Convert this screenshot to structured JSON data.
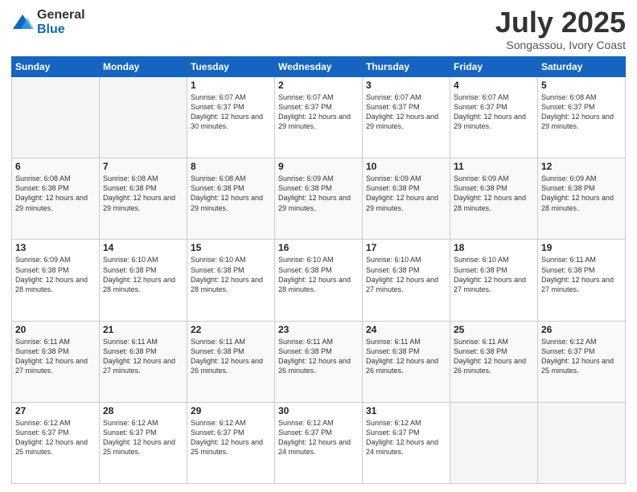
{
  "logo": {
    "general": "General",
    "blue": "Blue"
  },
  "title": {
    "month": "July 2025",
    "location": "Songassou, Ivory Coast"
  },
  "weekdays": [
    "Sunday",
    "Monday",
    "Tuesday",
    "Wednesday",
    "Thursday",
    "Friday",
    "Saturday"
  ],
  "weeks": [
    [
      {
        "day": "",
        "info": ""
      },
      {
        "day": "",
        "info": ""
      },
      {
        "day": "1",
        "info": "Sunrise: 6:07 AM\nSunset: 6:37 PM\nDaylight: 12 hours and 30 minutes."
      },
      {
        "day": "2",
        "info": "Sunrise: 6:07 AM\nSunset: 6:37 PM\nDaylight: 12 hours and 29 minutes."
      },
      {
        "day": "3",
        "info": "Sunrise: 6:07 AM\nSunset: 6:37 PM\nDaylight: 12 hours and 29 minutes."
      },
      {
        "day": "4",
        "info": "Sunrise: 6:07 AM\nSunset: 6:37 PM\nDaylight: 12 hours and 29 minutes."
      },
      {
        "day": "5",
        "info": "Sunrise: 6:08 AM\nSunset: 6:37 PM\nDaylight: 12 hours and 29 minutes."
      }
    ],
    [
      {
        "day": "6",
        "info": "Sunrise: 6:08 AM\nSunset: 6:38 PM\nDaylight: 12 hours and 29 minutes."
      },
      {
        "day": "7",
        "info": "Sunrise: 6:08 AM\nSunset: 6:38 PM\nDaylight: 12 hours and 29 minutes."
      },
      {
        "day": "8",
        "info": "Sunrise: 6:08 AM\nSunset: 6:38 PM\nDaylight: 12 hours and 29 minutes."
      },
      {
        "day": "9",
        "info": "Sunrise: 6:09 AM\nSunset: 6:38 PM\nDaylight: 12 hours and 29 minutes."
      },
      {
        "day": "10",
        "info": "Sunrise: 6:09 AM\nSunset: 6:38 PM\nDaylight: 12 hours and 29 minutes."
      },
      {
        "day": "11",
        "info": "Sunrise: 6:09 AM\nSunset: 6:38 PM\nDaylight: 12 hours and 28 minutes."
      },
      {
        "day": "12",
        "info": "Sunrise: 6:09 AM\nSunset: 6:38 PM\nDaylight: 12 hours and 28 minutes."
      }
    ],
    [
      {
        "day": "13",
        "info": "Sunrise: 6:09 AM\nSunset: 6:38 PM\nDaylight: 12 hours and 28 minutes."
      },
      {
        "day": "14",
        "info": "Sunrise: 6:10 AM\nSunset: 6:38 PM\nDaylight: 12 hours and 28 minutes."
      },
      {
        "day": "15",
        "info": "Sunrise: 6:10 AM\nSunset: 6:38 PM\nDaylight: 12 hours and 28 minutes."
      },
      {
        "day": "16",
        "info": "Sunrise: 6:10 AM\nSunset: 6:38 PM\nDaylight: 12 hours and 28 minutes."
      },
      {
        "day": "17",
        "info": "Sunrise: 6:10 AM\nSunset: 6:38 PM\nDaylight: 12 hours and 27 minutes."
      },
      {
        "day": "18",
        "info": "Sunrise: 6:10 AM\nSunset: 6:38 PM\nDaylight: 12 hours and 27 minutes."
      },
      {
        "day": "19",
        "info": "Sunrise: 6:11 AM\nSunset: 6:38 PM\nDaylight: 12 hours and 27 minutes."
      }
    ],
    [
      {
        "day": "20",
        "info": "Sunrise: 6:11 AM\nSunset: 6:38 PM\nDaylight: 12 hours and 27 minutes."
      },
      {
        "day": "21",
        "info": "Sunrise: 6:11 AM\nSunset: 6:38 PM\nDaylight: 12 hours and 27 minutes."
      },
      {
        "day": "22",
        "info": "Sunrise: 6:11 AM\nSunset: 6:38 PM\nDaylight: 12 hours and 26 minutes."
      },
      {
        "day": "23",
        "info": "Sunrise: 6:11 AM\nSunset: 6:38 PM\nDaylight: 12 hours and 26 minutes."
      },
      {
        "day": "24",
        "info": "Sunrise: 6:11 AM\nSunset: 6:38 PM\nDaylight: 12 hours and 26 minutes."
      },
      {
        "day": "25",
        "info": "Sunrise: 6:11 AM\nSunset: 6:38 PM\nDaylight: 12 hours and 26 minutes."
      },
      {
        "day": "26",
        "info": "Sunrise: 6:12 AM\nSunset: 6:37 PM\nDaylight: 12 hours and 25 minutes."
      }
    ],
    [
      {
        "day": "27",
        "info": "Sunrise: 6:12 AM\nSunset: 6:37 PM\nDaylight: 12 hours and 25 minutes."
      },
      {
        "day": "28",
        "info": "Sunrise: 6:12 AM\nSunset: 6:37 PM\nDaylight: 12 hours and 25 minutes."
      },
      {
        "day": "29",
        "info": "Sunrise: 6:12 AM\nSunset: 6:37 PM\nDaylight: 12 hours and 25 minutes."
      },
      {
        "day": "30",
        "info": "Sunrise: 6:12 AM\nSunset: 6:37 PM\nDaylight: 12 hours and 24 minutes."
      },
      {
        "day": "31",
        "info": "Sunrise: 6:12 AM\nSunset: 6:37 PM\nDaylight: 12 hours and 24 minutes."
      },
      {
        "day": "",
        "info": ""
      },
      {
        "day": "",
        "info": ""
      }
    ]
  ]
}
